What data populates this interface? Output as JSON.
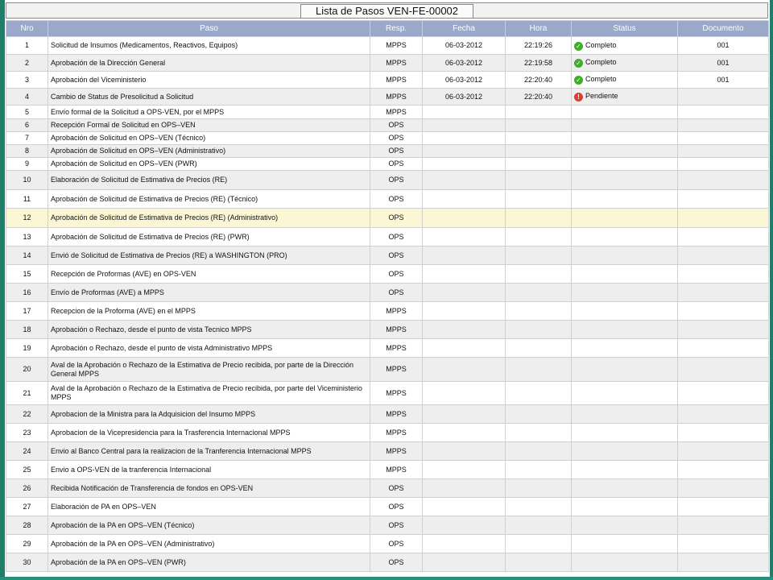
{
  "title": "Lista de Pasos VEN-FE-00002",
  "columns": [
    "Nro",
    "Paso",
    "Resp.",
    "Fecha",
    "Hora",
    "Status",
    "Documento"
  ],
  "colors": {
    "header_bg": "#9aa9c9",
    "highlight_row": "#fbf7d5",
    "status_ok": "#3fae2a",
    "status_pending": "#e23b2e",
    "frame": "#1e7e6a"
  },
  "rows": [
    {
      "nro": "1",
      "paso": "Solicitud de Insumos (Medicamentos, Reactivos, Equipos)",
      "resp": "MPPS",
      "fecha": "06-03-2012",
      "hora": "22:19:26",
      "status": "Completo",
      "status_icon": "check-circle-icon",
      "doc": "001"
    },
    {
      "nro": "2",
      "paso": "Aprobación de la Dirección General",
      "resp": "MPPS",
      "fecha": "06-03-2012",
      "hora": "22:19:58",
      "status": "Completo",
      "status_icon": "check-circle-icon",
      "doc": "001"
    },
    {
      "nro": "3",
      "paso": "Aprobación del Viceministerio",
      "resp": "MPPS",
      "fecha": "06-03-2012",
      "hora": "22:20:40",
      "status": "Completo",
      "status_icon": "check-circle-icon",
      "doc": "001"
    },
    {
      "nro": "4",
      "paso": "Cambio de Status de Presolicitud a Solicitud",
      "resp": "MPPS",
      "fecha": "06-03-2012",
      "hora": "22:20:40",
      "status": "Pendiente",
      "status_icon": "alert-circle-icon",
      "doc": ""
    },
    {
      "nro": "5",
      "paso": "Envío formal de la Solicitud a OPS-VEN, por el MPPS",
      "resp": "MPPS",
      "fecha": "",
      "hora": "",
      "status": "",
      "status_icon": "",
      "doc": ""
    },
    {
      "nro": "6",
      "paso": "Recepción Formal de Solicitud en OPS–VEN",
      "resp": "OPS",
      "fecha": "",
      "hora": "",
      "status": "",
      "status_icon": "",
      "doc": ""
    },
    {
      "nro": "7",
      "paso": "Aprobación de Solicitud en OPS–VEN (Técnico)",
      "resp": "OPS",
      "fecha": "",
      "hora": "",
      "status": "",
      "status_icon": "",
      "doc": ""
    },
    {
      "nro": "8",
      "paso": "Aprobación de Solicitud en OPS–VEN (Administrativo)",
      "resp": "OPS",
      "fecha": "",
      "hora": "",
      "status": "",
      "status_icon": "",
      "doc": ""
    },
    {
      "nro": "9",
      "paso": "Aprobación de Solicitud en OPS–VEN (PWR)",
      "resp": "OPS",
      "fecha": "",
      "hora": "",
      "status": "",
      "status_icon": "",
      "doc": ""
    },
    {
      "nro": "10",
      "paso": "Elaboración de Solicitud de Estimativa de Precios (RE)",
      "resp": "OPS",
      "fecha": "",
      "hora": "",
      "status": "",
      "status_icon": "",
      "doc": ""
    },
    {
      "nro": "11",
      "paso": "Aprobación de Solicitud de Estimativa de Precios (RE) (Técnico)",
      "resp": "OPS",
      "fecha": "",
      "hora": "",
      "status": "",
      "status_icon": "",
      "doc": ""
    },
    {
      "nro": "12",
      "paso": "Aprobación de Solicitud de Estimativa de Precios (RE) (Administrativo)",
      "resp": "OPS",
      "fecha": "",
      "hora": "",
      "status": "",
      "status_icon": "",
      "doc": ""
    },
    {
      "nro": "13",
      "paso": "Aprobación de Solicitud de Estimativa de Precios (RE) (PWR)",
      "resp": "OPS",
      "fecha": "",
      "hora": "",
      "status": "",
      "status_icon": "",
      "doc": ""
    },
    {
      "nro": "14",
      "paso": "Envió de Solicitud de Estimativa de Precios (RE) a WASHINGTON (PRO)",
      "resp": "OPS",
      "fecha": "",
      "hora": "",
      "status": "",
      "status_icon": "",
      "doc": ""
    },
    {
      "nro": "15",
      "paso": "Recepción de Proformas (AVE) en OPS-VEN",
      "resp": "OPS",
      "fecha": "",
      "hora": "",
      "status": "",
      "status_icon": "",
      "doc": ""
    },
    {
      "nro": "16",
      "paso": "Envío de Proformas (AVE) a MPPS",
      "resp": "OPS",
      "fecha": "",
      "hora": "",
      "status": "",
      "status_icon": "",
      "doc": ""
    },
    {
      "nro": "17",
      "paso": "Recepcion de la Proforma (AVE) en el MPPS",
      "resp": "MPPS",
      "fecha": "",
      "hora": "",
      "status": "",
      "status_icon": "",
      "doc": ""
    },
    {
      "nro": "18",
      "paso": "Aprobación o Rechazo, desde el punto de vista Tecnico MPPS",
      "resp": "MPPS",
      "fecha": "",
      "hora": "",
      "status": "",
      "status_icon": "",
      "doc": ""
    },
    {
      "nro": "19",
      "paso": "Aprobación o Rechazo, desde el punto de vista Administrativo MPPS",
      "resp": "MPPS",
      "fecha": "",
      "hora": "",
      "status": "",
      "status_icon": "",
      "doc": ""
    },
    {
      "nro": "20",
      "paso": "Aval de la Aprobación o Rechazo de la Estimativa de Precio recibida, por parte de la Dirección General MPPS",
      "resp": "MPPS",
      "fecha": "",
      "hora": "",
      "status": "",
      "status_icon": "",
      "doc": ""
    },
    {
      "nro": "21",
      "paso": "Aval de la Aprobación o Rechazo de la Estimativa de Precio recibida, por parte del Viceministerio MPPS",
      "resp": "MPPS",
      "fecha": "",
      "hora": "",
      "status": "",
      "status_icon": "",
      "doc": ""
    },
    {
      "nro": "22",
      "paso": "Aprobacion de la Ministra para la Adquisicion del Insumo MPPS",
      "resp": "MPPS",
      "fecha": "",
      "hora": "",
      "status": "",
      "status_icon": "",
      "doc": ""
    },
    {
      "nro": "23",
      "paso": "Aprobacion de la Vicepresidencia para la Trasferencia Internacional MPPS",
      "resp": "MPPS",
      "fecha": "",
      "hora": "",
      "status": "",
      "status_icon": "",
      "doc": ""
    },
    {
      "nro": "24",
      "paso": "Envio al Banco Central para la realizacion de la Tranferencia Internacional MPPS",
      "resp": "MPPS",
      "fecha": "",
      "hora": "",
      "status": "",
      "status_icon": "",
      "doc": ""
    },
    {
      "nro": "25",
      "paso": "Envio a OPS-VEN de la tranferencia Internacional",
      "resp": "MPPS",
      "fecha": "",
      "hora": "",
      "status": "",
      "status_icon": "",
      "doc": ""
    },
    {
      "nro": "26",
      "paso": "Recibida Notificación de Transferencia de fondos en OPS-VEN",
      "resp": "OPS",
      "fecha": "",
      "hora": "",
      "status": "",
      "status_icon": "",
      "doc": ""
    },
    {
      "nro": "27",
      "paso": "Elaboración de PA en OPS–VEN",
      "resp": "OPS",
      "fecha": "",
      "hora": "",
      "status": "",
      "status_icon": "",
      "doc": ""
    },
    {
      "nro": "28",
      "paso": "Aprobación de la PA en OPS–VEN (Técnico)",
      "resp": "OPS",
      "fecha": "",
      "hora": "",
      "status": "",
      "status_icon": "",
      "doc": ""
    },
    {
      "nro": "29",
      "paso": "Aprobación de la PA en OPS–VEN (Administrativo)",
      "resp": "OPS",
      "fecha": "",
      "hora": "",
      "status": "",
      "status_icon": "",
      "doc": ""
    },
    {
      "nro": "30",
      "paso": "Aprobación de la PA en OPS–VEN (PWR)",
      "resp": "OPS",
      "fecha": "",
      "hora": "",
      "status": "",
      "status_icon": "",
      "doc": ""
    }
  ]
}
